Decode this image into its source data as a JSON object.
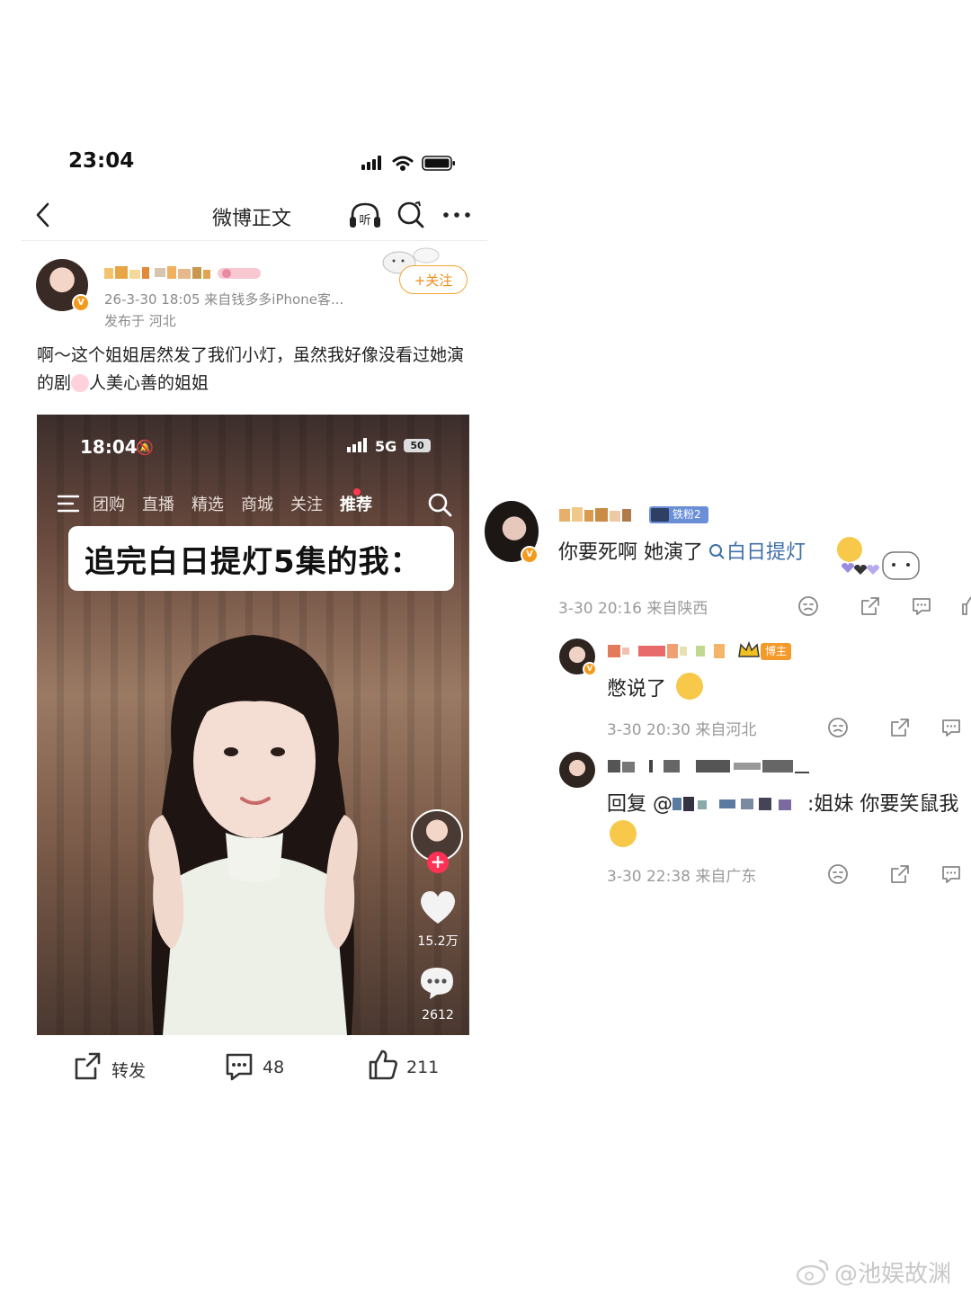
{
  "status_bar": {
    "time": "23:04"
  },
  "nav": {
    "title": "微博正文",
    "listen_label": "听"
  },
  "post": {
    "follow_label": "+关注",
    "meta": "26-3-30 18:05  来自钱多多iPhone客...",
    "location": "发布于 河北",
    "body_part1": "啊～这个姐姐居然发了我们小灯，虽然我好像没看过她演的剧",
    "body_part2": "人美心善的姐姐"
  },
  "video": {
    "time": "18:04",
    "network": "5G",
    "battery": "50",
    "tabs": [
      "团购",
      "直播",
      "精选",
      "商城",
      "关注",
      "推荐"
    ],
    "active_tab": "推荐",
    "caption": "追完白日提灯5集的我：",
    "like_count": "15.2万",
    "comment_count": "2612"
  },
  "actions": {
    "repost_label": "转发",
    "comment_count": "48",
    "like_count": "211"
  },
  "comments": [
    {
      "rank_label": "铁粉2",
      "text_prefix": "你要死啊 她演了",
      "topic": "白日提灯",
      "meta": "3-30 20:16  来自陕西"
    },
    {
      "tag": "博主",
      "text": "憋说了",
      "meta": "3-30 20:30  来自河北"
    },
    {
      "text_prefix": "回复 @",
      "text_suffix": ":姐妹 你要笑鼠我",
      "meta": "3-30 22:38  来自广东"
    }
  ],
  "watermark": {
    "text": "@池娱故渊"
  },
  "colors": {
    "accent_orange": "#f08b16",
    "topic_blue": "#3f6fa8",
    "meta_gray": "#9a9a9a"
  }
}
